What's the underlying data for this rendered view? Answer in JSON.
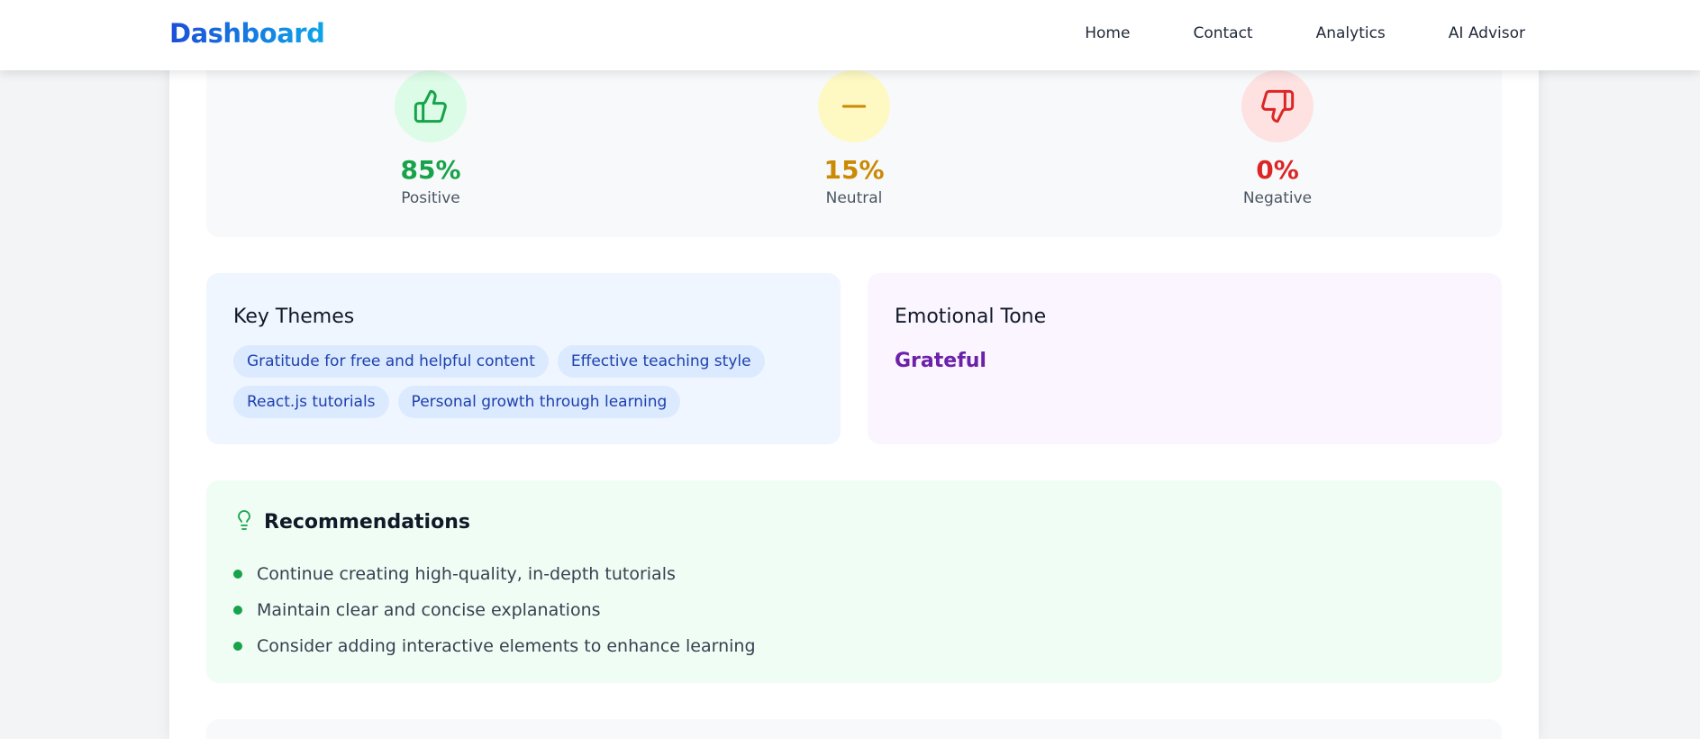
{
  "navbar": {
    "brand": "Dashboard",
    "links": [
      "Home",
      "Contact",
      "Analytics",
      "AI Advisor"
    ]
  },
  "sentiment": {
    "positive": {
      "value": "85%",
      "label": "Positive",
      "icon": "thumbs-up-icon",
      "color": "#16a34a",
      "bg": "#dcfce7"
    },
    "neutral": {
      "value": "15%",
      "label": "Neutral",
      "icon": "minus-icon",
      "color": "#ca8a04",
      "bg": "#fef9c3"
    },
    "negative": {
      "value": "0%",
      "label": "Negative",
      "icon": "thumbs-down-icon",
      "color": "#dc2626",
      "bg": "#fee2e2"
    }
  },
  "themes": {
    "title": "Key Themes",
    "items": [
      "Gratitude for free and helpful content",
      "Effective teaching style",
      "React.js tutorials",
      "Personal growth through learning"
    ]
  },
  "tone": {
    "title": "Emotional Tone",
    "value": "Grateful"
  },
  "recommendations": {
    "title": "Recommendations",
    "icon": "lightbulb-icon",
    "items": [
      "Continue creating high-quality, in-depth tutorials",
      "Maintain clear and concise explanations",
      "Consider adding interactive elements to enhance learning"
    ]
  }
}
